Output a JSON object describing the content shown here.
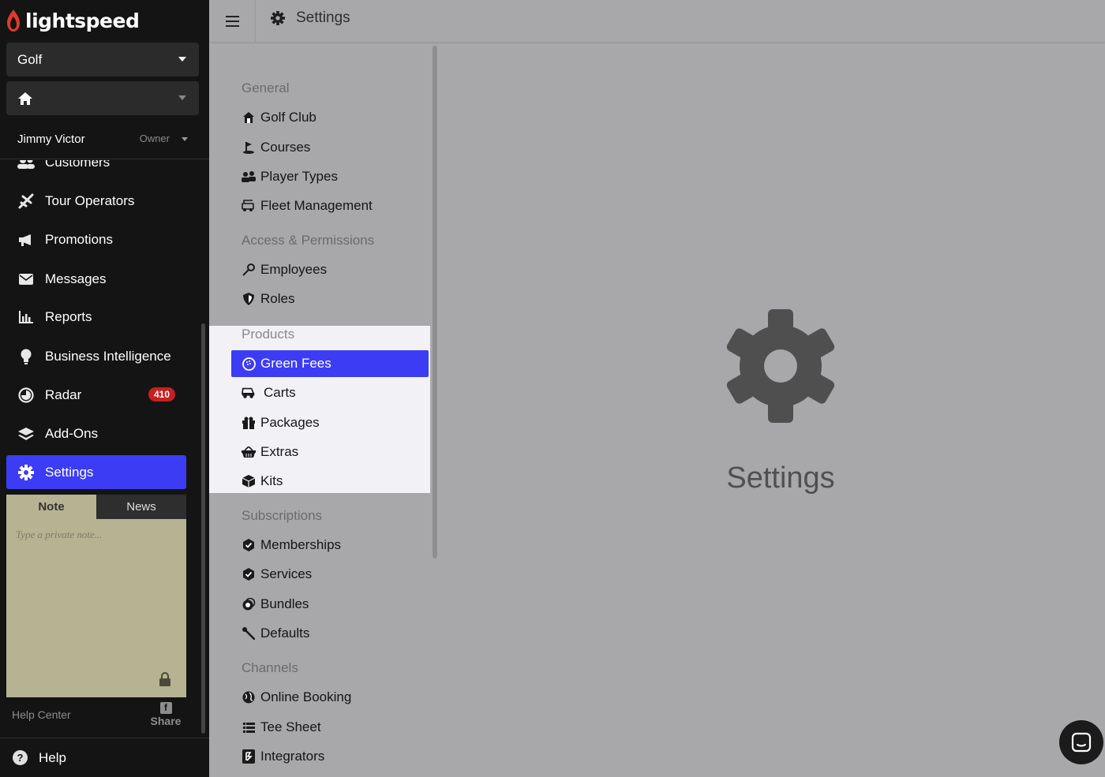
{
  "brand": {
    "name": "lightspeed",
    "accent": "#3d3cf5",
    "logo_color": "#e03a2d"
  },
  "sidebar": {
    "business_select": "Golf",
    "user_name": "Jimmy Victor",
    "user_role": "Owner",
    "nav": [
      {
        "label": "Customers",
        "icon": "users-icon"
      },
      {
        "label": "Tour Operators",
        "icon": "plane-icon"
      },
      {
        "label": "Promotions",
        "icon": "megaphone-icon"
      },
      {
        "label": "Messages",
        "icon": "envelope-icon"
      },
      {
        "label": "Reports",
        "icon": "bar-chart-icon"
      },
      {
        "label": "Business Intelligence",
        "icon": "lightbulb-icon"
      },
      {
        "label": "Radar",
        "icon": "radar-icon",
        "badge": "410"
      },
      {
        "label": "Add-Ons",
        "icon": "layers-icon"
      },
      {
        "label": "Settings",
        "icon": "gear-icon",
        "active": true
      }
    ],
    "note": {
      "tab_note": "Note",
      "tab_news": "News",
      "placeholder": "Type a private note..."
    },
    "help_center": "Help Center",
    "share": "Share",
    "help": "Help"
  },
  "topbar": {
    "title": "Settings"
  },
  "settings_menu": {
    "groups": [
      {
        "label": "General",
        "items": [
          {
            "label": "Golf Club",
            "icon": "clubhouse-icon"
          },
          {
            "label": "Courses",
            "icon": "golf-flag-icon"
          },
          {
            "label": "Player Types",
            "icon": "users-icon"
          },
          {
            "label": "Fleet Management",
            "icon": "fleet-icon"
          }
        ]
      },
      {
        "label": "Access & Permissions",
        "items": [
          {
            "label": "Employees",
            "icon": "key-icon"
          },
          {
            "label": "Roles",
            "icon": "shield-icon"
          }
        ]
      },
      {
        "label": "Products",
        "items": [
          {
            "label": "Green Fees",
            "icon": "golf-ball-icon",
            "selected": true
          },
          {
            "label": "Carts",
            "icon": "golf-cart-icon"
          },
          {
            "label": "Packages",
            "icon": "gift-icon"
          },
          {
            "label": "Extras",
            "icon": "basket-icon"
          },
          {
            "label": "Kits",
            "icon": "box-icon"
          }
        ]
      },
      {
        "label": "Subscriptions",
        "items": [
          {
            "label": "Memberships",
            "icon": "badge-check-icon"
          },
          {
            "label": "Services",
            "icon": "badge-check-icon"
          },
          {
            "label": "Bundles",
            "icon": "stack-icon"
          },
          {
            "label": "Defaults",
            "icon": "wrench-icon"
          }
        ]
      },
      {
        "label": "Channels",
        "items": [
          {
            "label": "Online Booking",
            "icon": "globe-icon"
          },
          {
            "label": "Tee Sheet",
            "icon": "list-icon"
          },
          {
            "label": "Integrators",
            "icon": "plug-icon"
          }
        ]
      }
    ]
  },
  "main": {
    "placeholder_title": "Settings",
    "placeholder_icon": "gear-icon"
  }
}
